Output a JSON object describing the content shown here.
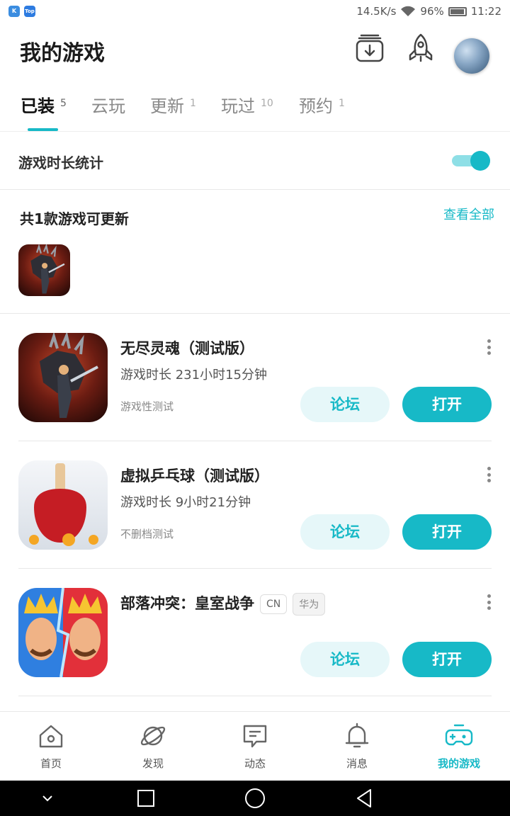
{
  "status_bar": {
    "net_speed": "14.5K/s",
    "battery": "96%",
    "time": "11:22",
    "apps": [
      {
        "icon": "kuan-app-icon",
        "label": "K"
      },
      {
        "icon": "top-app-icon",
        "label": "Top"
      }
    ]
  },
  "header": {
    "title": "我的游戏",
    "icons": [
      "download-manager-icon",
      "rocket-icon",
      "avatar"
    ]
  },
  "tabs": [
    {
      "label": "已装",
      "count": "5",
      "active": true
    },
    {
      "label": "云玩",
      "count": "",
      "active": false
    },
    {
      "label": "更新",
      "count": "1",
      "active": false
    },
    {
      "label": "玩过",
      "count": "10",
      "active": false
    },
    {
      "label": "预约",
      "count": "1",
      "active": false
    }
  ],
  "stats": {
    "label": "游戏时长统计",
    "toggle_on": true
  },
  "updates": {
    "title": "共1款游戏可更新",
    "view_all": "查看全部"
  },
  "games": [
    {
      "name": "无尽灵魂（测试版）",
      "playtime": "游戏时长 231小时15分钟",
      "tag": "游戏性测试",
      "forum": "论坛",
      "open": "打开",
      "badges": []
    },
    {
      "name": "虚拟乒乓球（测试版）",
      "playtime": "游戏时长 9小时21分钟",
      "tag": "不删档测试",
      "forum": "论坛",
      "open": "打开",
      "badges": []
    },
    {
      "name": "部落冲突：皇室战争",
      "playtime": "",
      "tag": "",
      "forum": "论坛",
      "open": "打开",
      "badges": [
        "CN",
        "华为"
      ]
    }
  ],
  "bottom_nav": [
    {
      "label": "首页",
      "icon": "home-icon",
      "active": false
    },
    {
      "label": "发现",
      "icon": "planet-icon",
      "active": false
    },
    {
      "label": "动态",
      "icon": "chat-icon",
      "active": false
    },
    {
      "label": "消息",
      "icon": "bell-icon",
      "active": false
    },
    {
      "label": "我的游戏",
      "icon": "gamepad-icon",
      "active": true
    }
  ],
  "colors": {
    "accent": "#17b9c7",
    "accent_light": "#e6f7f9"
  }
}
